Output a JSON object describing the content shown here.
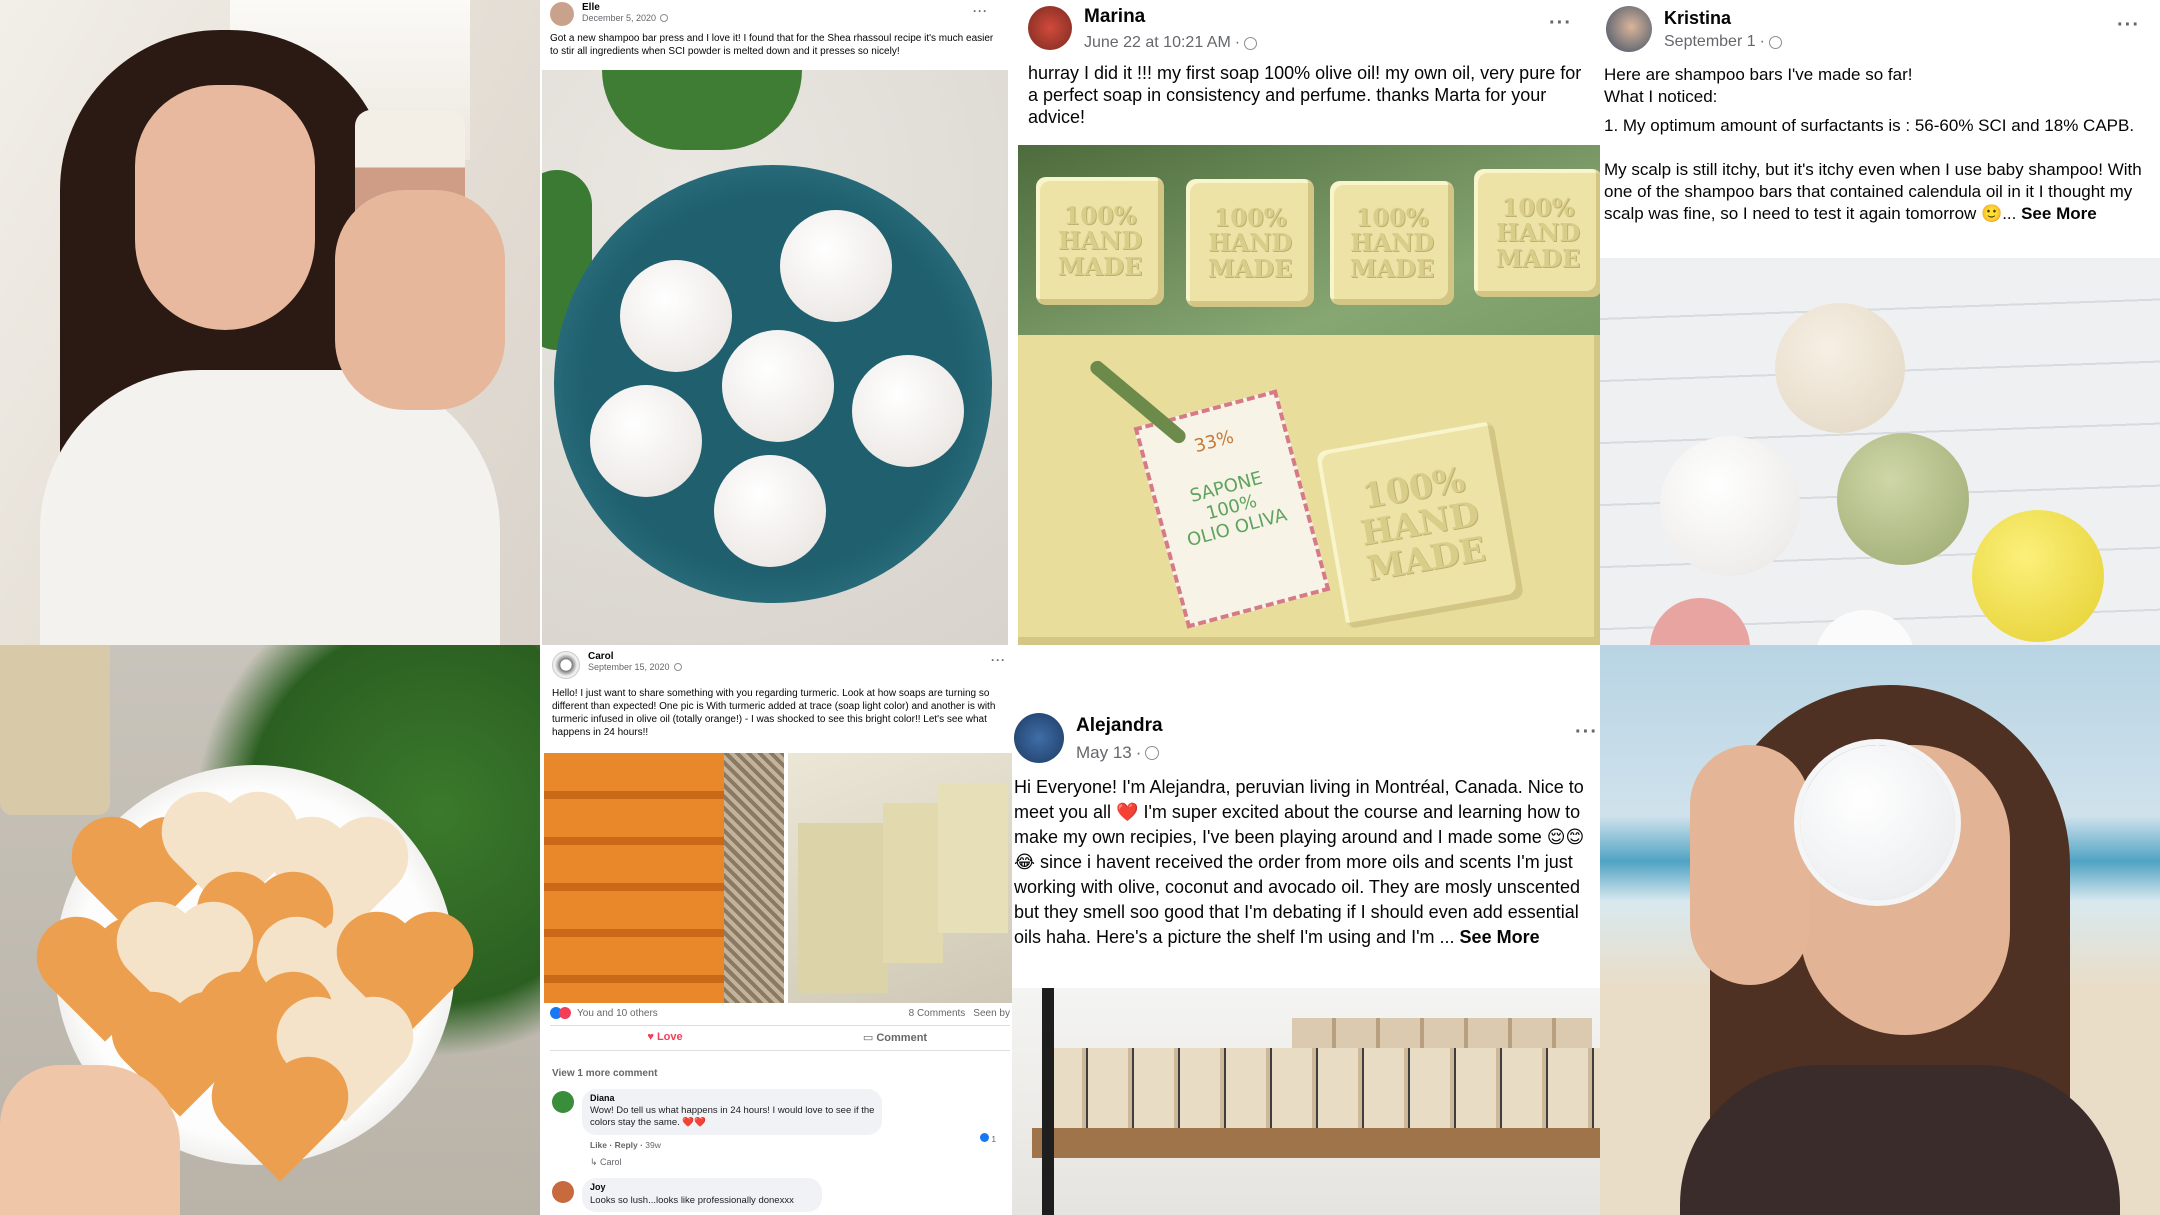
{
  "collage": {
    "elle": {
      "name": "Elle",
      "date": "December 5, 2020",
      "more": "···",
      "text": "Got a new shampoo bar press and I love it! I found that for the Shea rhassoul recipe it's much easier to stir all ingredients when SCI powder is melted down and it presses so nicely!"
    },
    "marina": {
      "name": "Marina",
      "date": "June 22 at 10:21 AM",
      "more": "···",
      "text": "hurray I did it !!! my first soap 100% olive oil! my own oil, very pure for a perfect soap in consistency and perfume. thanks Marta for your advice!",
      "stamp_text": "100% HAND MADE",
      "tag_line1": "33%",
      "tag_line2": "SAPONE",
      "tag_line3": "100%",
      "tag_line4": "OLIO OLIVA"
    },
    "kristina": {
      "name": "Kristina",
      "date": "September 1",
      "more": "···",
      "line1": "Here are shampoo bars I've made so far!",
      "line2": "What I noticed:",
      "line3": "1. My optimum amount of surfactants is : 56-60% SCI and 18% CAPB.",
      "line4": "My scalp is still itchy, but it's itchy even when I use baby shampoo! With one of the shampoo bars that contained calendula oil in it I thought my scalp was fine, so I need to test it again tomorrow 🙂...",
      "see_more": "See More"
    },
    "carol": {
      "name": "Carol",
      "date": "September 15, 2020",
      "more": "···",
      "text": "Hello! I just want to share something with you regarding turmeric. Look at how soaps are turning so different than expected! One pic is With turmeric added at trace (soap light color) and another is with turmeric infused in olive oil (totally orange!) - I was shocked to see this bright color!! Let's see what happens in 24 hours!!",
      "reactions": "You and 10 others",
      "comments_count": "8 Comments",
      "seen_by": "Seen by",
      "love_label": "Love",
      "comment_label": "Comment",
      "view_more": "View 1 more comment",
      "c1_name": "Diana",
      "c1_text": "Wow! Do tell us what happens in 24 hours! I would love to see if the colors stay the same. ❤️❤️",
      "c1_like": "Like",
      "c1_reply": "Reply",
      "c1_time": "39w",
      "c1_count": "1",
      "c1_reply_by": "Carol",
      "c2_name": "Joy",
      "c2_text": "Looks so lush...looks like professionally donexxx"
    },
    "alejandra": {
      "name": "Alejandra",
      "date": "May 13",
      "more": "···",
      "text": "Hi Everyone! I'm Alejandra, peruvian living in Montréal, Canada. Nice to meet you all ❤️ I'm super excited about the course and learning how to make my own recipies, I've been playing around and I made some 😌😊😂 since i havent received the order from more oils and scents I'm just working with olive, coconut and avocado oil. They are mosly unscented but they smell soo good that I'm debating if I should even add essential oils haha. Here's a picture the shelf I'm using and I'm ...",
      "see_more": "See More"
    }
  },
  "colors": {
    "fb_text": "#050505",
    "fb_meta": "#65676b",
    "love": "#f33e58",
    "plate_blue": "#1f5f6e"
  }
}
